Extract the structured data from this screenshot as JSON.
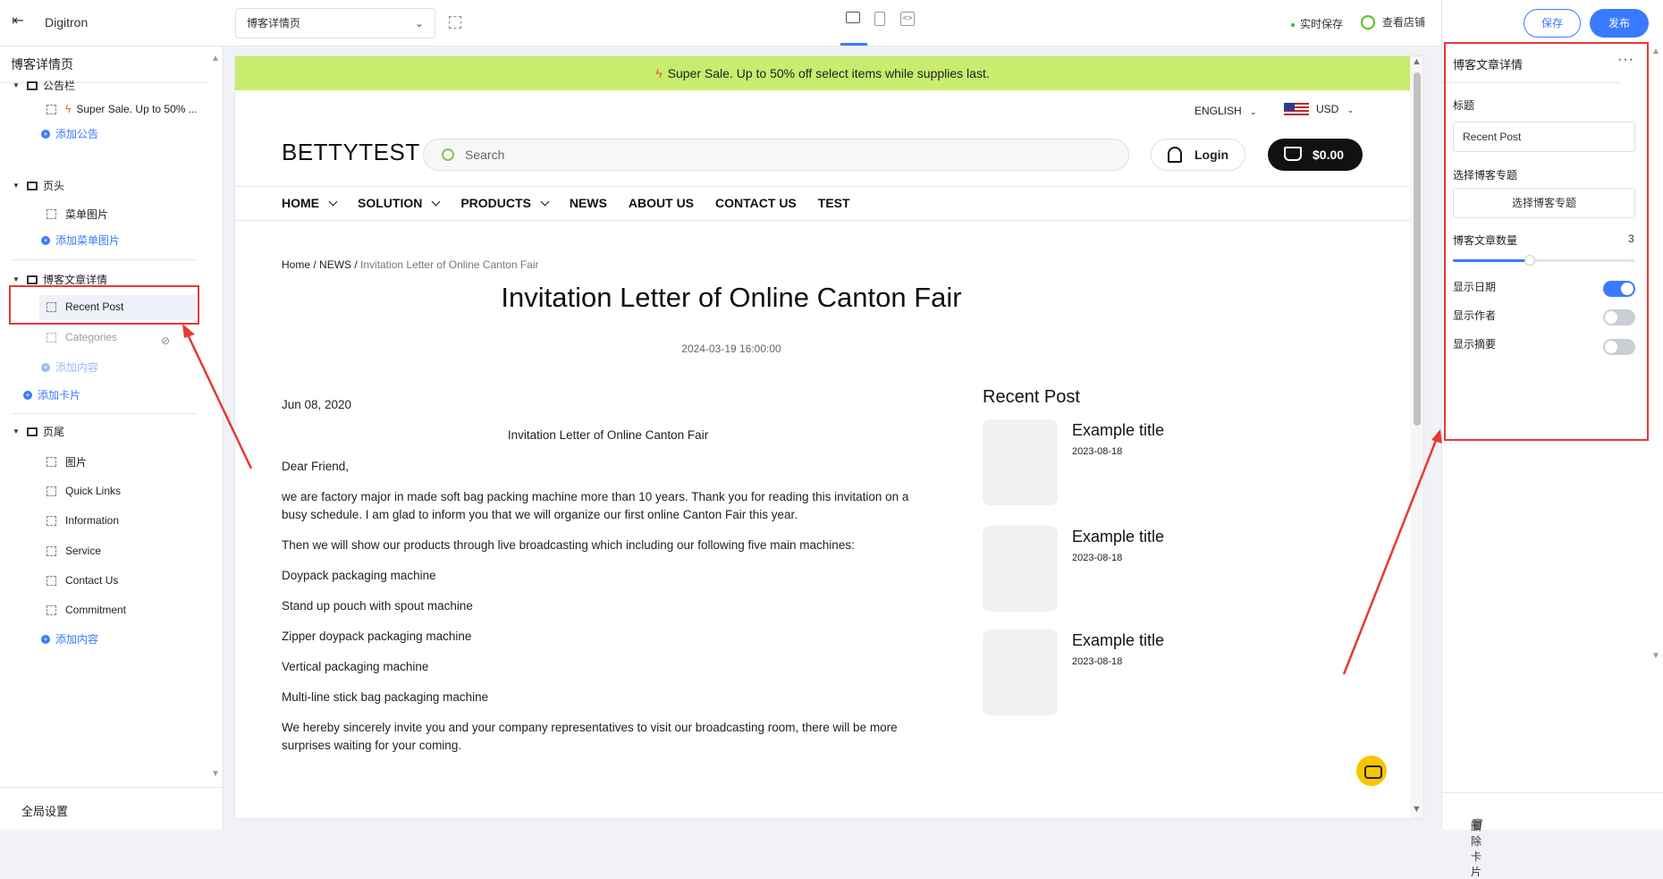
{
  "topbar": {
    "brand": "Digitron",
    "page_select": "博客详情页",
    "autosave": "实时保存",
    "view_store": "查看店铺",
    "save": "保存",
    "publish": "发布"
  },
  "left_panel": {
    "title": "博客详情页",
    "sections": [
      {
        "label": "公告栏",
        "items": [
          "Super Sale. Up to 50% ..."
        ],
        "add": "添加公告"
      },
      {
        "label": "页头",
        "items": [
          "菜单图片"
        ],
        "add": "添加菜单图片"
      },
      {
        "label": "博客文章详情",
        "items": [
          "Recent Post",
          "Categories"
        ],
        "add": "添加内容"
      },
      {
        "label": "页尾",
        "items": [
          "图片",
          "Quick Links",
          "Information",
          "Service",
          "Contact Us",
          "Commitment"
        ],
        "add": "添加内容"
      }
    ],
    "add_card": "添加卡片",
    "footer": "全局设置"
  },
  "preview": {
    "announcement": "Super Sale. Up to 50% off select items while supplies last.",
    "language": "ENGLISH",
    "currency": "USD",
    "logo": "BETTYTEST",
    "search_placeholder": "Search",
    "login": "Login",
    "cart": "$0.00",
    "nav": [
      "HOME",
      "SOLUTION",
      "PRODUCTS",
      "NEWS",
      "ABOUT US",
      "CONTACT US",
      "TEST"
    ],
    "breadcrumb": {
      "home": "Home",
      "news": "NEWS",
      "current": "Invitation Letter of Online Canton Fair",
      "sep": " / "
    },
    "post_title": "Invitation Letter of Online Canton Fair",
    "post_date": "2024-03-19 16:00:00",
    "article": {
      "date": "Jun 08, 2020",
      "heading": "Invitation Letter of Online Canton Fair",
      "paragraphs": [
        "Dear Friend,",
        "we are factory major in made soft bag packing machine more than 10 years. Thank you for reading this invitation on a busy schedule. I am glad to inform you that we will organize our first online Canton Fair this year.",
        "Then we will show our products through live broadcasting which including our following five main machines:",
        "Doypack packaging machine",
        "Stand up pouch with spout machine",
        "Zipper doypack packaging machine",
        "Vertical packaging machine",
        "Multi-line stick bag packaging machine",
        "We hereby sincerely invite you and your company representatives to visit our broadcasting room, there will be more surprises waiting for your coming."
      ]
    },
    "recent_post": {
      "heading": "Recent Post",
      "items": [
        {
          "title": "Example title",
          "date": "2023-08-18"
        },
        {
          "title": "Example title",
          "date": "2023-08-18"
        },
        {
          "title": "Example title",
          "date": "2023-08-18"
        }
      ]
    }
  },
  "right_panel": {
    "title": "博客文章详情",
    "more": "···",
    "title_label": "标题",
    "title_value": "Recent Post",
    "topic_label": "选择博客专题",
    "topic_button": "选择博客专题",
    "count_label": "博客文章数量",
    "count_value": "3",
    "count_fraction": 0.42,
    "show_date": "显示日期",
    "show_date_on": true,
    "show_author": "显示作者",
    "show_author_on": false,
    "show_summary": "显示摘要",
    "show_summary_on": false,
    "delete_card": "删除卡片"
  },
  "colors": {
    "accent": "#3a7afe",
    "announce_bg": "#c7ec6e",
    "highlight": "#e53935"
  }
}
